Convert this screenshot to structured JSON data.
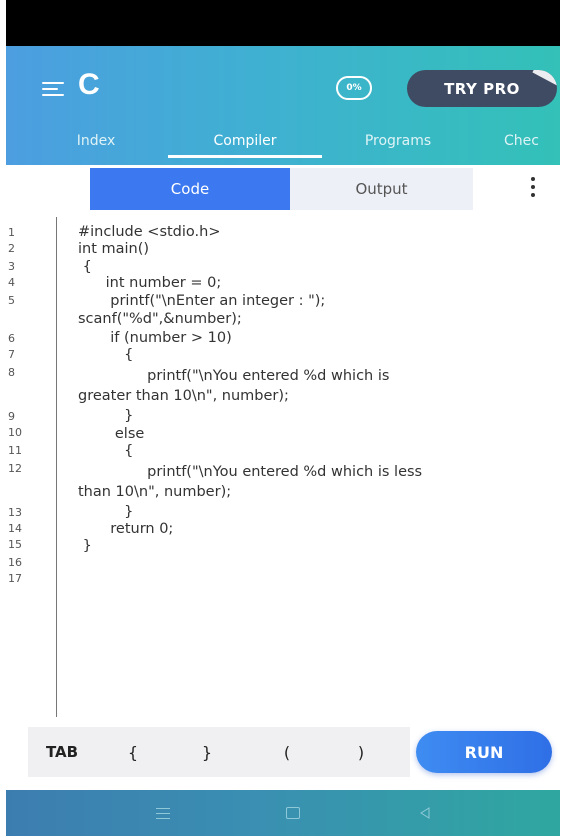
{
  "header": {
    "logo": "C",
    "progress": "0%",
    "try_pro_label": "TRY PRO"
  },
  "tabs": [
    {
      "label": "Index"
    },
    {
      "label": "Compiler"
    },
    {
      "label": "Programs"
    },
    {
      "label": "Chec"
    }
  ],
  "toggle": {
    "code_label": "Code",
    "output_label": "Output"
  },
  "editor": {
    "line_numbers": [
      "1",
      "2",
      "3",
      "4",
      "5",
      "6",
      "7",
      "8",
      "9",
      "10",
      "11",
      "12",
      "13",
      "14",
      "15",
      "16",
      "17"
    ],
    "code_lines": [
      "#include <stdio.h>",
      "int main()",
      " {",
      "      int number = 0;",
      "       printf(\"\\nEnter an integer : \");",
      "scanf(\"%d\",&number);",
      "       if (number > 10)",
      "          {",
      "               printf(\"\\nYou entered %d which is",
      "greater than 10\\n\", number);",
      "          }",
      "        else",
      "          {",
      "               printf(\"\\nYou entered %d which is less",
      "than 10\\n\", number);",
      "          }",
      "       return 0;",
      " }"
    ]
  },
  "keybar": {
    "tab_label": "TAB",
    "open_brace": "{",
    "close_brace": "}",
    "open_paren": "(",
    "close_paren": ")",
    "run_label": "RUN"
  },
  "colors": {
    "header_start": "#4c9ee0",
    "header_end": "#33c1b8",
    "accent_blue": "#3c79f0",
    "try_pro_bg": "#3f4b63"
  }
}
